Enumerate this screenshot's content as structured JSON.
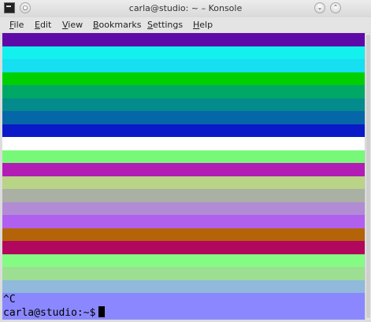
{
  "window": {
    "title": "carla@studio: ~ – Konsole"
  },
  "menu": {
    "items": [
      {
        "first": "F",
        "rest": "ile"
      },
      {
        "first": "E",
        "rest": "dit"
      },
      {
        "first": "V",
        "rest": "iew"
      },
      {
        "first": "B",
        "rest": "ookmarks"
      },
      {
        "first": "S",
        "rest": "ettings"
      },
      {
        "first": "H",
        "rest": "elp"
      }
    ]
  },
  "terminal": {
    "stripe_colors": [
      "#5e0aa8",
      "#14f0ee",
      "#15dff0",
      "#00d000",
      "#00a865",
      "#048b8b",
      "#0566a8",
      "#0a1ac8",
      "#ffffff",
      "#78f878",
      "#b21db5",
      "#b9d487",
      "#aab0a4",
      "#b28bd5",
      "#b05fee",
      "#b46408",
      "#b1085d",
      "#84fc84",
      "#9cdf93",
      "#90b9db"
    ],
    "prompt_bg": "#8b88ff",
    "interrupt_line": "^C",
    "prompt_line": "carla@studio:~$"
  }
}
